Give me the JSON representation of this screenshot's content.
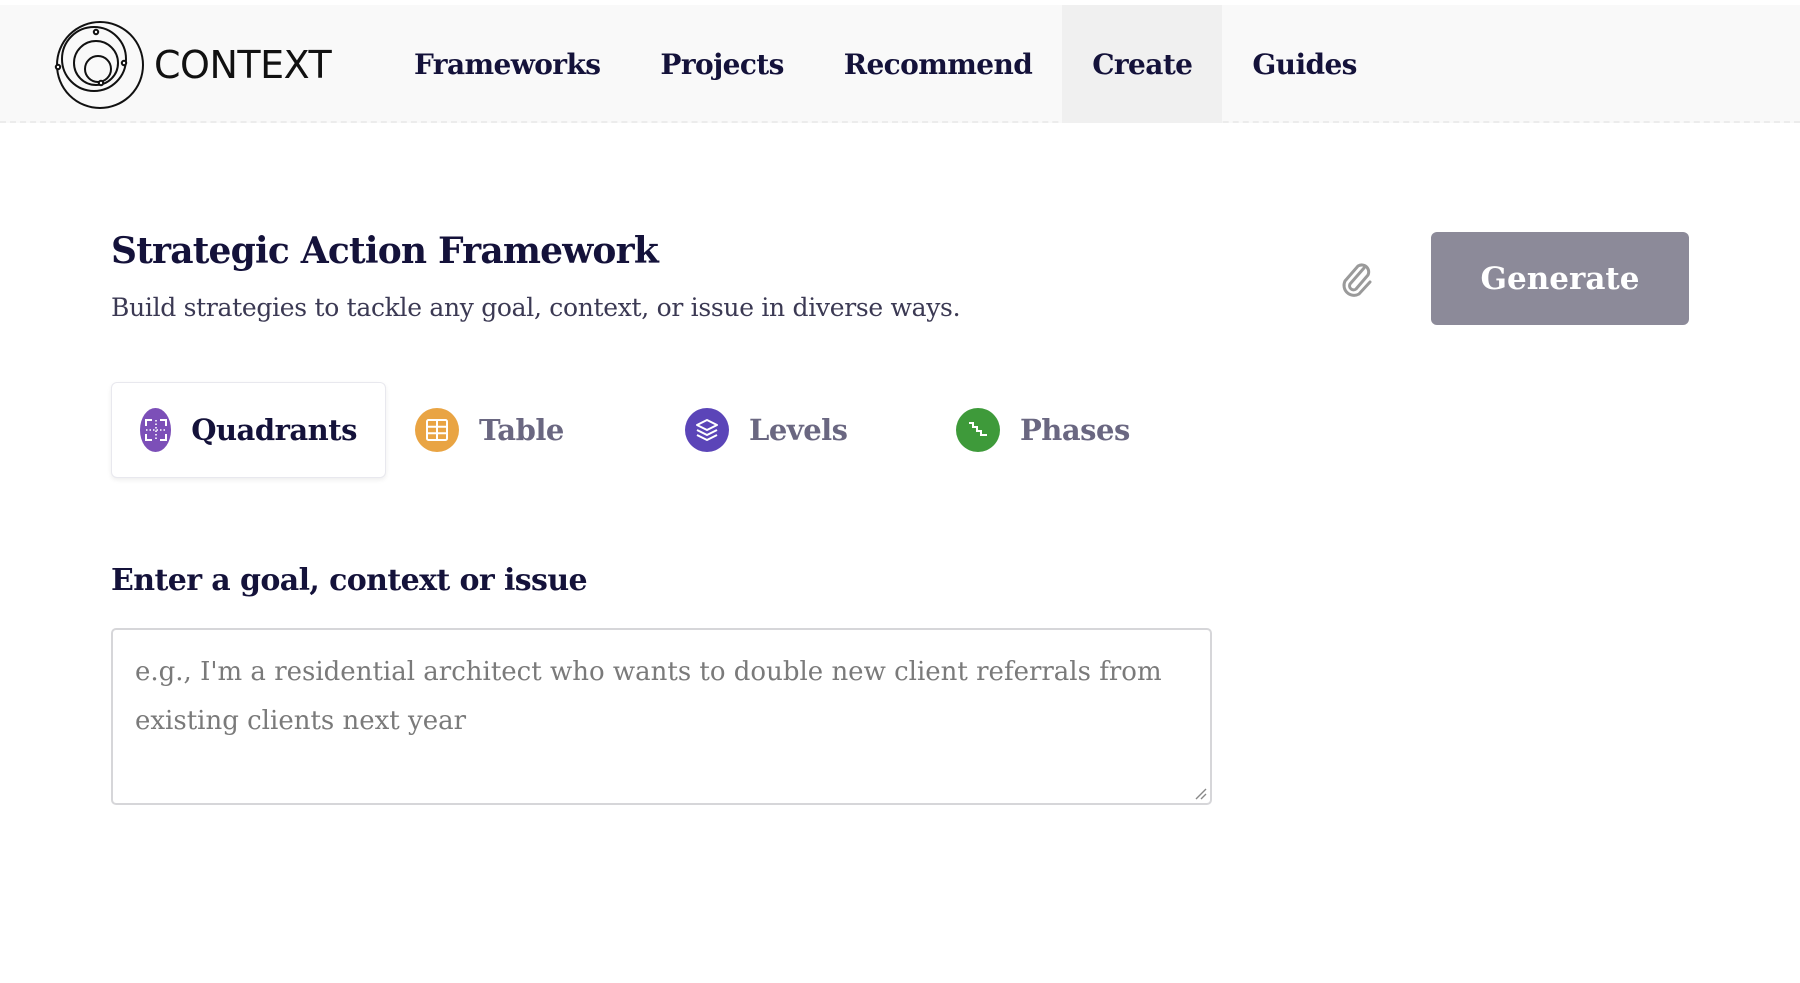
{
  "header": {
    "logo_text": "CONTEXT",
    "nav": [
      {
        "label": "Frameworks",
        "active": false
      },
      {
        "label": "Projects",
        "active": false
      },
      {
        "label": "Recommend",
        "active": false
      },
      {
        "label": "Create",
        "active": true
      },
      {
        "label": "Guides",
        "active": false
      }
    ]
  },
  "page": {
    "title": "Strategic Action Framework",
    "subtitle": "Build strategies to tackle any goal, context, or issue in diverse ways.",
    "attach_icon": "paperclip-icon",
    "generate_label": "Generate"
  },
  "tabs": [
    {
      "label": "Quadrants",
      "icon": "quadrants-icon",
      "color": "#7c4fb8",
      "active": true
    },
    {
      "label": "Table",
      "icon": "table-grid-icon",
      "color": "#e9a443",
      "active": false
    },
    {
      "label": "Levels",
      "icon": "layers-icon",
      "color": "#5b45b8",
      "active": false
    },
    {
      "label": "Phases",
      "icon": "stairs-icon",
      "color": "#3e9a3a",
      "active": false
    }
  ],
  "input": {
    "label": "Enter a goal, context or issue",
    "value": "",
    "placeholder": "e.g., I'm a residential architect who wants to double new client referrals from existing clients next year"
  },
  "colors": {
    "text_primary": "#14123a",
    "generate_bg": "#8c8a99",
    "header_bg": "#f9f9f9",
    "active_nav_bg": "#f0f0f0"
  }
}
